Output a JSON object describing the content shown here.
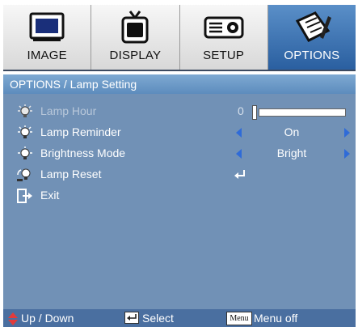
{
  "tabs": [
    {
      "label": "IMAGE",
      "icon": "monitor-icon"
    },
    {
      "label": "DISPLAY",
      "icon": "tv-icon"
    },
    {
      "label": "SETUP",
      "icon": "projector-icon"
    },
    {
      "label": "OPTIONS",
      "icon": "pencil-note-icon",
      "active": true
    }
  ],
  "title": "OPTIONS / Lamp Setting",
  "rows": {
    "lamp_hour": {
      "label": "Lamp Hour",
      "value": "0"
    },
    "lamp_reminder": {
      "label": "Lamp Reminder",
      "value": "On"
    },
    "brightness_mode": {
      "label": "Brightness Mode",
      "value": "Bright"
    },
    "lamp_reset": {
      "label": "Lamp Reset"
    },
    "exit": {
      "label": "Exit"
    }
  },
  "footer": {
    "updown": "Up / Down",
    "select": "Select",
    "menu_key": "Menu",
    "menuoff": "Menu off"
  },
  "colors": {
    "accent_arrow": "#2f6bd8",
    "active_tab": "#3a6fb0",
    "panel": "#7191b6"
  }
}
